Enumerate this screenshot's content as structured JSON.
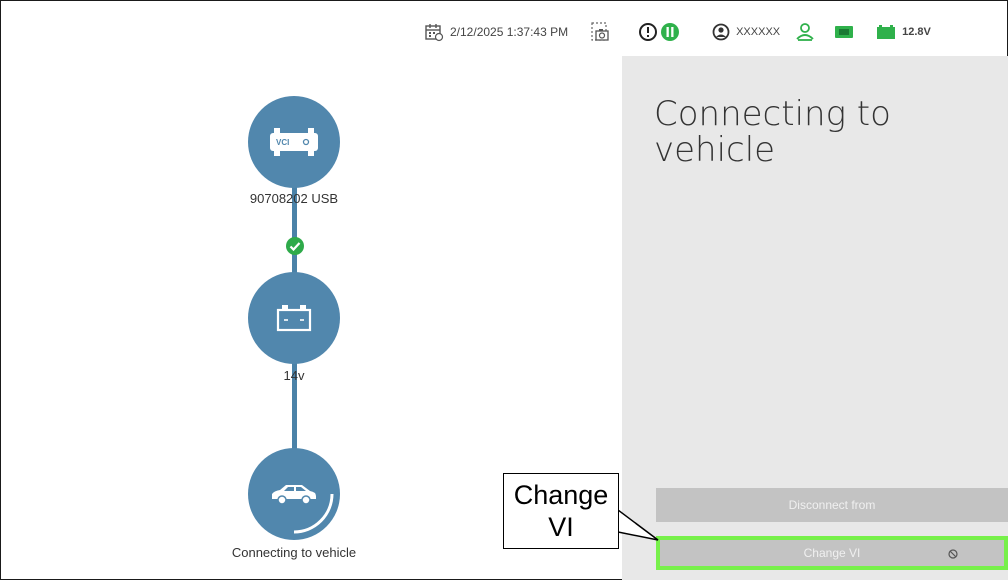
{
  "status_bar": {
    "datetime": "2/12/2025 1:37:43 PM",
    "user": "XXXXXX",
    "voltage": "12.8V"
  },
  "flow": {
    "vci_badge": "VCI",
    "vci_label": "90708202 USB",
    "battery_label": "14v",
    "vehicle_label": "Connecting to vehicle"
  },
  "panel": {
    "title": "Connecting to vehicle",
    "disconnect_label": "Disconnect from",
    "change_vi_label": "Change VI"
  },
  "callout": {
    "text_line1": "Change",
    "text_line2": "VI"
  },
  "colors": {
    "node_blue": "#5187ad",
    "check_green": "#2eaa4a",
    "status_green": "#2fb14b",
    "highlight_green": "#77f04a",
    "panel_gray": "#e8e8e8"
  }
}
